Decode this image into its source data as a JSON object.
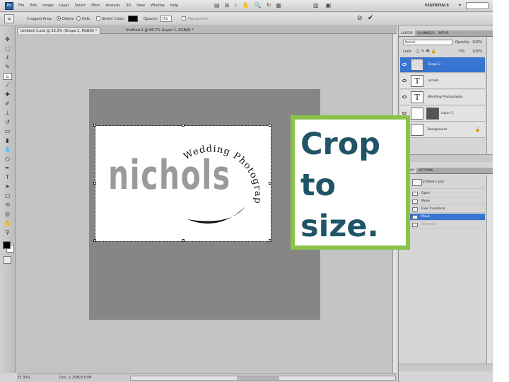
{
  "app": {
    "logo": "Ps",
    "menus": [
      "File",
      "Edit",
      "Image",
      "Layer",
      "Select",
      "Filter",
      "Analysis",
      "3D",
      "View",
      "Window",
      "Help"
    ],
    "workspace": "ESSENTIALS",
    "zoom": "66.7"
  },
  "options_bar": {
    "mode_label": "Cropped Area:",
    "radio_delete": "Delete",
    "radio_hide": "Hide",
    "shield_label": "Shield",
    "color_label": "Color:",
    "opacity_label": "Opacity:",
    "opacity_value": "75%",
    "perspective_label": "Perspective"
  },
  "document_tabs": [
    {
      "label": "Untitled-1.psd @ 33.3% (Shape 2, RGB/8) *",
      "active": true
    },
    {
      "label": "Untitled-1 @ 66.7% (Layer 1, RGB/8) *",
      "active": false
    }
  ],
  "canvas": {
    "logo_text": "nichols",
    "arc_text": "Wedding Photography"
  },
  "callout": {
    "line1": "Crop",
    "line2": "to",
    "line3": "size."
  },
  "status": {
    "zoom": "33.33%",
    "doc": "Doc: 2.25M/3.03M"
  },
  "layers_panel": {
    "tabs": [
      "LAYERS",
      "CHANNELS",
      "PATHS"
    ],
    "blend_mode": "Normal",
    "opacity_label": "Opacity:",
    "opacity_value": "100%",
    "lock_label": "Lock:",
    "fill_label": "Fill:",
    "fill_value": "100%",
    "layers": [
      {
        "name": "Shape 2",
        "type": "shape",
        "selected": true
      },
      {
        "name": "nichols",
        "type": "text",
        "selected": false
      },
      {
        "name": "Wedding Photography",
        "type": "text",
        "selected": false
      },
      {
        "name": "Layer 1",
        "type": "masked",
        "selected": false
      },
      {
        "name": "Background",
        "type": "background",
        "selected": false
      }
    ]
  },
  "history_panel": {
    "tabs": [
      "HISTORY",
      "ACTIONS"
    ],
    "snapshot": "Untitled-1.psd",
    "items": [
      {
        "label": "Open",
        "state": "normal"
      },
      {
        "label": "Move",
        "state": "normal"
      },
      {
        "label": "Free Transform",
        "state": "normal"
      },
      {
        "label": "Move",
        "state": "selected"
      },
      {
        "label": "Rasterize",
        "state": "dim"
      }
    ]
  }
}
